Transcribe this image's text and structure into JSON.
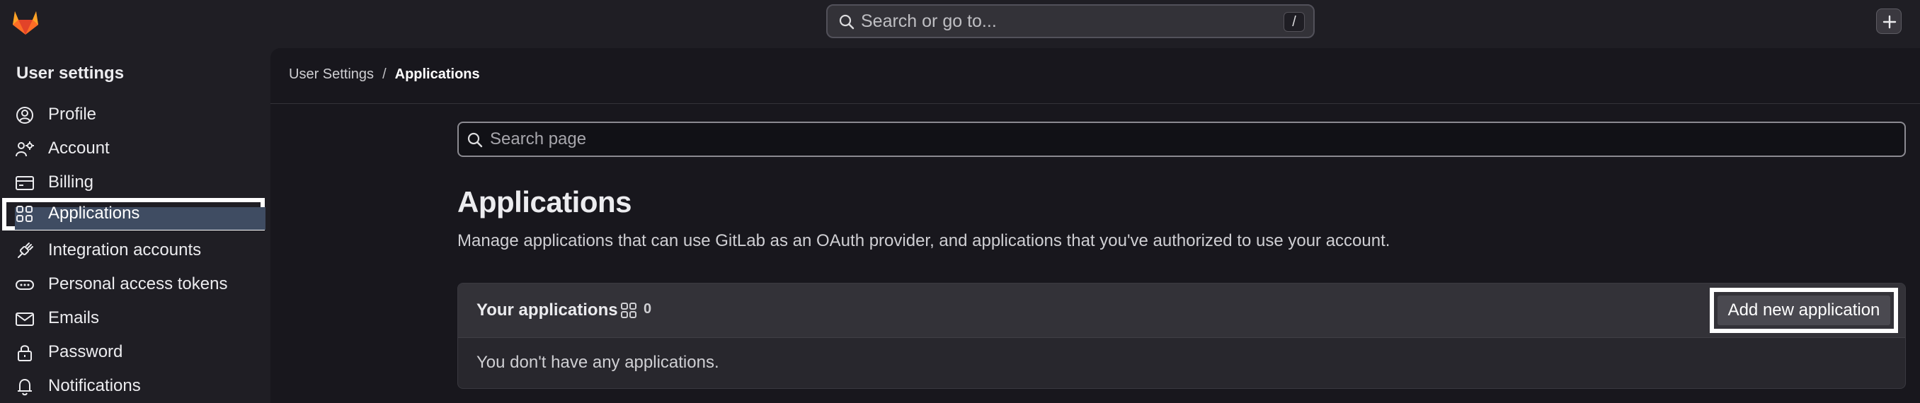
{
  "topbar": {
    "search_placeholder": "Search or go to...",
    "search_shortcut": "/",
    "icons": [
      "gitlab-logo",
      "search-icon",
      "plus-icon"
    ]
  },
  "sidebar": {
    "title": "User settings",
    "items": [
      {
        "label": "Profile",
        "icon": "profile-icon"
      },
      {
        "label": "Account",
        "icon": "account-icon"
      },
      {
        "label": "Billing",
        "icon": "billing-icon"
      },
      {
        "label": "Applications",
        "icon": "applications-icon",
        "active": true
      },
      {
        "label": "Integration accounts",
        "icon": "integration-icon"
      },
      {
        "label": "Personal access tokens",
        "icon": "token-icon"
      },
      {
        "label": "Emails",
        "icon": "email-icon"
      },
      {
        "label": "Password",
        "icon": "lock-icon"
      },
      {
        "label": "Notifications",
        "icon": "bell-icon"
      }
    ]
  },
  "breadcrumb": {
    "parent": "User Settings",
    "separator": "/",
    "current": "Applications"
  },
  "main": {
    "search_placeholder": "Search page",
    "title": "Applications",
    "description": "Manage applications that can use GitLab as an OAuth provider, and applications that you've authorized to use your account.",
    "card": {
      "title": "Your applications",
      "count": "0",
      "add_button": "Add new application",
      "empty_text": "You don't have any applications."
    }
  },
  "colors": {
    "background": "#1f1e24",
    "main_background": "#18171d",
    "active_item": "#3f4c62",
    "text": "#ececef",
    "logo_orange": "#e24329"
  }
}
